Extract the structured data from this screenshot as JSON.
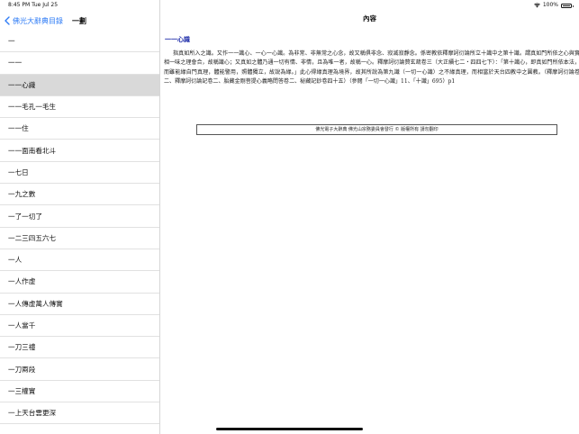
{
  "status_bar": {
    "time": "8:45 PM",
    "date": "Tue Jul 25",
    "battery_text": "100%"
  },
  "sidebar": {
    "back_label": "佛光大辭典目錄",
    "title": "一劃",
    "items": [
      {
        "label": "一"
      },
      {
        "label": "一一"
      },
      {
        "label": "一一心識",
        "selected": true
      },
      {
        "label": "一一毛孔一毛生"
      },
      {
        "label": "一一住"
      },
      {
        "label": "一一面南看北斗"
      },
      {
        "label": "一七日"
      },
      {
        "label": "一九之數"
      },
      {
        "label": "一了一切了"
      },
      {
        "label": "一二三四五六七"
      },
      {
        "label": "一人"
      },
      {
        "label": "一人作虛"
      },
      {
        "label": "一人傳虛萬人傳實"
      },
      {
        "label": "一人當千"
      },
      {
        "label": "一刀三禮"
      },
      {
        "label": "一刀兩段"
      },
      {
        "label": "一三權實"
      },
      {
        "label": "一上天台雲更深"
      },
      {
        "label": ""
      }
    ]
  },
  "content": {
    "title": "內容",
    "entry_heading": "一一心識",
    "body": "指真如所入之識。又作一一識心、一心一心識。為非常、非無常之心念，故又稱俱非念、寂滅寂靜念。係密教依釋摩訶衍論所立十識中之第十識。謂真如門所依之心與實相一味之理會合，故稱識心；又真如之體乃通一切有情、非情，且為唯一者，故稱一心。釋摩訶衍論贊玄疏卷三（大正續七二‧四四七下）：「第十識心，即真如門所依本法，而雖能緣自門真理，體能警用，照體獨立，故說為緣。」此心得緣真理為境界，故其所說為第九識（一切一心識）之不緣真理，而相當於天台四教中之圓教。（釋摩訶衍論卷二、釋摩訶衍論記卷二、胎藏金剛菩提心義略問答卷二、秘藏記鈔卷四十五）（參閱「一切一心識」11、「十識」695）p1",
    "copyright": "佛光電子大辭典  佛光山宗務委員會發行  © 版權所有  請勿翻印"
  }
}
